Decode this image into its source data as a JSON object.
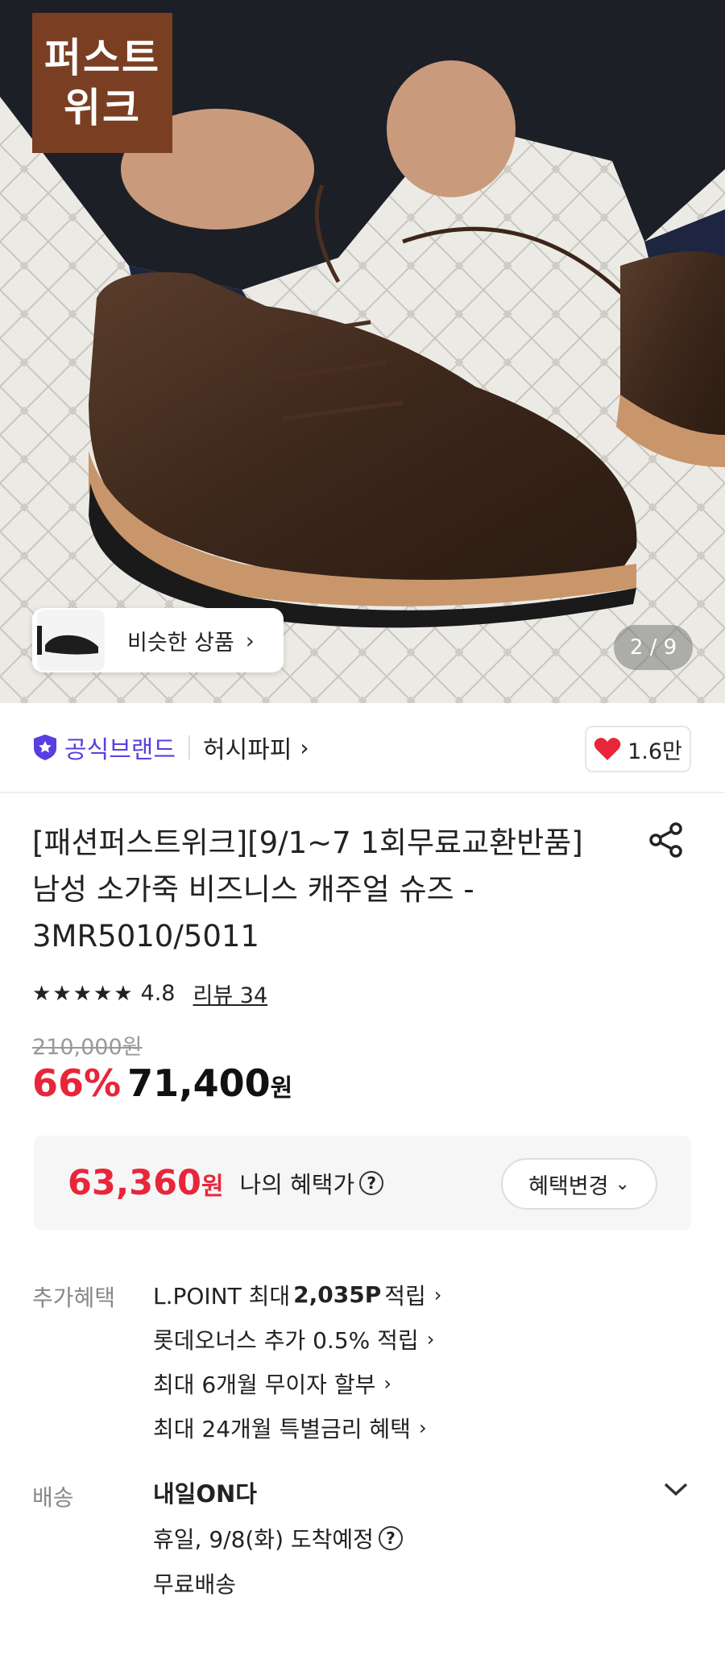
{
  "hero": {
    "brand_badge_line1": "퍼스트",
    "brand_badge_line2": "위크",
    "similar_label": "비슷한 상품",
    "page_indicator": "2 / 9"
  },
  "brand_row": {
    "official_label": "공식브랜드",
    "store_name": "허시파피",
    "like_count": "1.6만"
  },
  "product": {
    "title_line1": "[패션퍼스트위크][9/1~7 1회무료교환반품]",
    "title_line2": "남성 소가죽 비즈니스 캐주얼 슈즈 -",
    "title_line3": "3MR5010/5011",
    "rating": 4.8,
    "rating_text": "4.8",
    "stars": "★★★★★",
    "review_label": "리뷰 34",
    "original_price": "210,000원",
    "discount": "66%",
    "sale_price": "71,400",
    "currency": "원"
  },
  "benefit_box": {
    "price": "63,360",
    "currency": "원",
    "label": "나의 혜택가",
    "change_label": "혜택변경"
  },
  "extra_benefits": {
    "label": "추가혜택",
    "items": [
      {
        "pre": "L.POINT 최대",
        "bold": "2,035P",
        "post": "적립"
      },
      {
        "pre": "롯데오너스 추가 0.5% 적립",
        "bold": "",
        "post": ""
      },
      {
        "pre": "최대 6개월 무이자 할부",
        "bold": "",
        "post": ""
      },
      {
        "pre": "최대 24개월 특별금리 혜택",
        "bold": "",
        "post": ""
      }
    ]
  },
  "delivery": {
    "label": "배송",
    "title": "내일ON다",
    "arrival": "휴일, 9/8(화) 도착예정",
    "fee": "무료배송"
  },
  "colors": {
    "accent_red": "#e8263a",
    "official_purple": "#5b3ee0",
    "brand_badge": "#7a3e22"
  }
}
